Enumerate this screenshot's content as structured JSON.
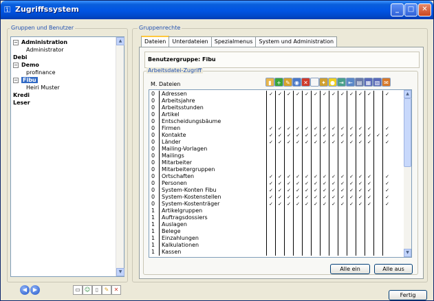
{
  "window": {
    "title": "Zugriffssystem"
  },
  "left_panel": {
    "label": "Gruppen und Benutzer",
    "tree": [
      {
        "label": "Administration",
        "bold": true,
        "expander": "−"
      },
      {
        "label": "Administrator",
        "bold": false,
        "expander": ""
      },
      {
        "label": "Debi",
        "bold": true,
        "expander": ""
      },
      {
        "label": "Demo",
        "bold": true,
        "expander": "−"
      },
      {
        "label": "profinance",
        "bold": false,
        "expander": ""
      },
      {
        "label": "Fibu",
        "bold": true,
        "expander": "−",
        "selected": true
      },
      {
        "label": "Heiri Muster",
        "bold": false,
        "expander": ""
      },
      {
        "label": "Kredi",
        "bold": true,
        "expander": ""
      },
      {
        "label": "Leser",
        "bold": true,
        "expander": ""
      }
    ]
  },
  "right_panel": {
    "label": "Gruppenrechte",
    "tabs": [
      "Dateien",
      "Unterdateien",
      "Spezialmenus",
      "System und Administration"
    ],
    "active_tab": 0,
    "group_title": "Benutzergruppe: Fibu",
    "section_label": "Arbeitsdatei-Zugriff",
    "column_header": "M. Dateien",
    "rows": [
      {
        "num": "0",
        "name": "Adressen",
        "checks": [
          1,
          1,
          1,
          1,
          1,
          1,
          1,
          1,
          1,
          1,
          1,
          1,
          0,
          1
        ]
      },
      {
        "num": "0",
        "name": "Arbeitsjahre",
        "checks": [
          0,
          0,
          0,
          0,
          0,
          0,
          0,
          0,
          0,
          0,
          0,
          0,
          0,
          0
        ]
      },
      {
        "num": "0",
        "name": "Arbeitsstunden",
        "checks": [
          0,
          0,
          0,
          0,
          0,
          0,
          0,
          0,
          0,
          0,
          0,
          0,
          0,
          0
        ]
      },
      {
        "num": "0",
        "name": "Artikel",
        "checks": [
          0,
          0,
          0,
          0,
          0,
          0,
          0,
          0,
          0,
          0,
          0,
          0,
          0,
          0
        ]
      },
      {
        "num": "0",
        "name": "Entscheidungsbäume",
        "checks": [
          0,
          0,
          0,
          0,
          0,
          0,
          0,
          0,
          0,
          0,
          0,
          0,
          0,
          0
        ]
      },
      {
        "num": "0",
        "name": "Firmen",
        "checks": [
          1,
          1,
          1,
          1,
          1,
          1,
          1,
          1,
          1,
          1,
          1,
          1,
          0,
          1
        ]
      },
      {
        "num": "0",
        "name": "Kontakte",
        "checks": [
          1,
          1,
          1,
          1,
          1,
          1,
          1,
          1,
          1,
          1,
          1,
          1,
          1,
          1
        ]
      },
      {
        "num": "0",
        "name": "Länder",
        "checks": [
          1,
          1,
          1,
          1,
          1,
          1,
          1,
          1,
          1,
          1,
          1,
          1,
          0,
          1
        ]
      },
      {
        "num": "0",
        "name": "Mailing-Vorlagen",
        "checks": [
          0,
          0,
          0,
          0,
          0,
          0,
          0,
          0,
          0,
          0,
          0,
          0,
          0,
          0
        ]
      },
      {
        "num": "0",
        "name": "Mailings",
        "checks": [
          0,
          0,
          0,
          0,
          0,
          0,
          0,
          0,
          0,
          0,
          0,
          0,
          0,
          0
        ]
      },
      {
        "num": "0",
        "name": "Mitarbeiter",
        "checks": [
          0,
          0,
          0,
          0,
          0,
          0,
          0,
          0,
          0,
          0,
          0,
          0,
          0,
          0
        ]
      },
      {
        "num": "0",
        "name": "Mitarbeitergruppen",
        "checks": [
          0,
          0,
          0,
          0,
          0,
          0,
          0,
          0,
          0,
          0,
          0,
          0,
          0,
          0
        ]
      },
      {
        "num": "0",
        "name": "Ortschaften",
        "checks": [
          1,
          1,
          1,
          1,
          1,
          1,
          1,
          1,
          1,
          1,
          1,
          1,
          0,
          1
        ]
      },
      {
        "num": "0",
        "name": "Personen",
        "checks": [
          1,
          1,
          1,
          1,
          1,
          1,
          1,
          1,
          1,
          1,
          1,
          1,
          0,
          1
        ]
      },
      {
        "num": "0",
        "name": "System-Konten Fibu",
        "checks": [
          1,
          1,
          1,
          1,
          1,
          1,
          1,
          1,
          1,
          1,
          1,
          1,
          0,
          1
        ]
      },
      {
        "num": "0",
        "name": "System-Kostenstellen",
        "checks": [
          1,
          1,
          1,
          1,
          1,
          1,
          1,
          1,
          1,
          1,
          1,
          1,
          0,
          1
        ]
      },
      {
        "num": "0",
        "name": "System-Kostenträger",
        "checks": [
          1,
          1,
          1,
          1,
          1,
          1,
          1,
          1,
          1,
          1,
          1,
          1,
          0,
          1
        ]
      },
      {
        "num": "1",
        "name": "Artikelgruppen",
        "checks": [
          0,
          0,
          0,
          0,
          0,
          0,
          0,
          0,
          0,
          0,
          0,
          0,
          0,
          0
        ]
      },
      {
        "num": "1",
        "name": "Auftragsdossiers",
        "checks": [
          0,
          0,
          0,
          0,
          0,
          0,
          0,
          0,
          0,
          0,
          0,
          0,
          0,
          0
        ]
      },
      {
        "num": "1",
        "name": "Auslagen",
        "checks": [
          0,
          0,
          0,
          0,
          0,
          0,
          0,
          0,
          0,
          0,
          0,
          0,
          0,
          0
        ]
      },
      {
        "num": "1",
        "name": "Belege",
        "checks": [
          0,
          0,
          0,
          0,
          0,
          0,
          0,
          0,
          0,
          0,
          0,
          0,
          0,
          0
        ]
      },
      {
        "num": "1",
        "name": "Einzahlungen",
        "checks": [
          0,
          0,
          0,
          0,
          0,
          0,
          0,
          0,
          0,
          0,
          0,
          0,
          0,
          0
        ]
      },
      {
        "num": "1",
        "name": "Kalkulationen",
        "checks": [
          0,
          0,
          0,
          0,
          0,
          0,
          0,
          0,
          0,
          0,
          0,
          0,
          0,
          0
        ]
      },
      {
        "num": "1",
        "name": "Kassen",
        "checks": [
          0,
          0,
          0,
          0,
          0,
          0,
          0,
          0,
          0,
          0,
          0,
          0,
          0,
          0
        ]
      }
    ],
    "check_glyph": "✓",
    "toolbar_icons": [
      {
        "name": "folder-icon",
        "glyph": "▮",
        "color": "#e8b64a"
      },
      {
        "name": "add-icon",
        "glyph": "+",
        "color": "#3aa53a"
      },
      {
        "name": "pencil-icon",
        "glyph": "✎",
        "color": "#d9a22a"
      },
      {
        "name": "magnify-icon",
        "glyph": "◉",
        "color": "#4a78c8"
      },
      {
        "name": "delete-icon",
        "glyph": "✕",
        "color": "#d03a2a"
      },
      {
        "name": "page-icon",
        "glyph": "▭",
        "color": "#f5f5f5"
      },
      {
        "name": "star-icon",
        "glyph": "✦",
        "color": "#d0a030"
      },
      {
        "name": "bulb-icon",
        "glyph": "●",
        "color": "#f0d020"
      },
      {
        "name": "export-icon",
        "glyph": "⇥",
        "color": "#4aa08a"
      },
      {
        "name": "import-icon",
        "glyph": "⇤",
        "color": "#5a88c8"
      },
      {
        "name": "print-icon",
        "glyph": "▤",
        "color": "#6a7aa8"
      },
      {
        "name": "save-icon",
        "glyph": "▦",
        "color": "#5a6ab8"
      },
      {
        "name": "disk-icon",
        "glyph": "▧",
        "color": "#5a6ab8"
      },
      {
        "name": "attach-icon",
        "glyph": "✉",
        "color": "#d87a2a"
      }
    ],
    "btn_all_on": "Alle ein",
    "btn_all_off": "Alle aus"
  },
  "footer": {
    "nav_prev": "◀",
    "nav_next": "▶",
    "tools": [
      {
        "name": "new-icon",
        "glyph": "▭",
        "color": "#333"
      },
      {
        "name": "user-add-icon",
        "glyph": "☺",
        "color": "#2a8a3a"
      },
      {
        "name": "copy-icon",
        "glyph": "▯",
        "color": "#666"
      },
      {
        "name": "edit-icon",
        "glyph": "✎",
        "color": "#d9a22a"
      },
      {
        "name": "delete-icon",
        "glyph": "✕",
        "color": "#d03a2a"
      }
    ],
    "done_label": "Fertig"
  }
}
